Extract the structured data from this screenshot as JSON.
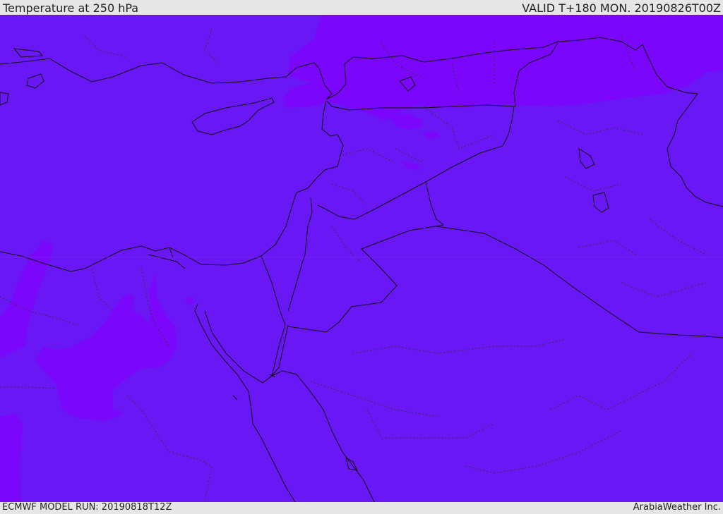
{
  "header": {
    "title": "Temperature at 250 hPa",
    "valid_time": "VALID T+180 MON. 20190826T00Z"
  },
  "footer": {
    "model_run": "ECMWF MODEL RUN: 20190818T12Z",
    "credit": "ArabiaWeather Inc."
  },
  "colors": {
    "base_field": "#6a17f6",
    "warm_field": "#7a07fb",
    "border_line": "#111111",
    "background": "#e6e6e6"
  }
}
